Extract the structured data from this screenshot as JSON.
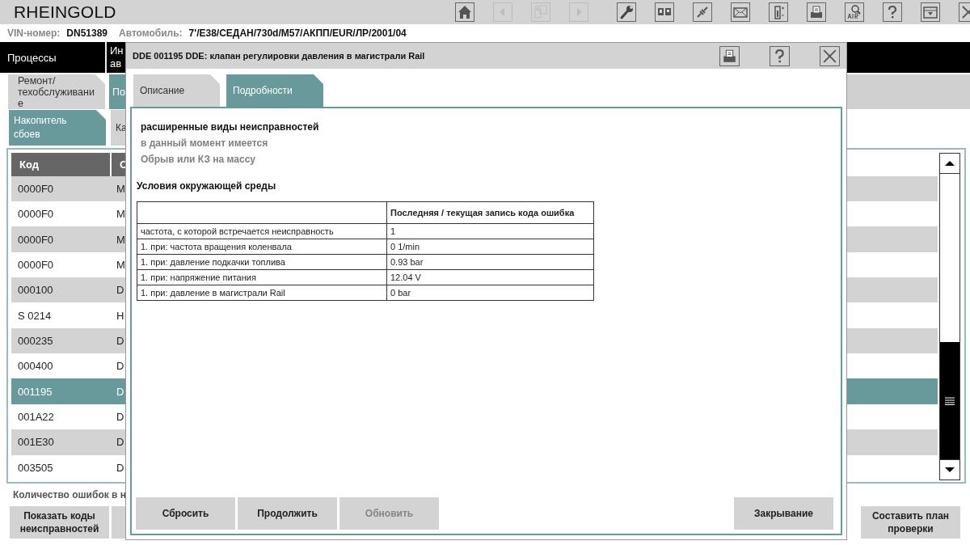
{
  "app": {
    "title": "RHEINGOLD"
  },
  "toolbar": [
    {
      "kind": "home",
      "disabled": false
    },
    {
      "kind": "back",
      "disabled": true
    },
    {
      "kind": "documents",
      "disabled": true
    },
    {
      "kind": "forward",
      "disabled": true
    },
    {
      "kind": "wrench",
      "disabled": false
    },
    {
      "kind": "panels",
      "disabled": false
    },
    {
      "kind": "plug",
      "disabled": false
    },
    {
      "kind": "mail",
      "disabled": false
    },
    {
      "kind": "battery",
      "disabled": false
    },
    {
      "kind": "print",
      "disabled": false
    },
    {
      "kind": "air",
      "disabled": false
    },
    {
      "kind": "help",
      "disabled": false
    },
    {
      "kind": "filter",
      "disabled": false
    },
    {
      "kind": "close",
      "disabled": false
    }
  ],
  "vehicle": {
    "vin_label": "VIN-номер:",
    "vin": "DN51389",
    "car_label": "Автомобиль:",
    "car": "7'/E38/СЕДАН/730d/M57/АКПП/EUR/ЛР/2001/04"
  },
  "nav_tabs": [
    {
      "lines": [
        "Процессы"
      ]
    },
    {
      "lines": [
        "Ин",
        "ав"
      ]
    }
  ],
  "sub_tabs": [
    {
      "lines": [
        "Ремонт/",
        "техобслуживани",
        "е"
      ],
      "selected": false
    },
    {
      "lines": [
        "По"
      ],
      "selected": true
    }
  ],
  "section_tabs": [
    {
      "lines": [
        "Накопитель",
        "сбоев"
      ],
      "selected": true
    },
    {
      "lines": [
        "Ка"
      ],
      "selected": false
    }
  ],
  "fault_table": {
    "columns": [
      "Код",
      "С"
    ],
    "rows": [
      {
        "cells": [
          "0000F0",
          "M"
        ],
        "selected": false
      },
      {
        "cells": [
          "0000F0",
          "M"
        ],
        "selected": false
      },
      {
        "cells": [
          "0000F0",
          "M"
        ],
        "selected": false
      },
      {
        "cells": [
          "0000F0",
          "M"
        ],
        "selected": false
      },
      {
        "cells": [
          "000100",
          "D"
        ],
        "selected": false
      },
      {
        "cells": [
          "S 0214",
          "H"
        ],
        "selected": false
      },
      {
        "cells": [
          "000235",
          "D"
        ],
        "selected": false
      },
      {
        "cells": [
          "000400",
          "D"
        ],
        "selected": false
      },
      {
        "cells": [
          "001195",
          "D"
        ],
        "selected": true
      },
      {
        "cells": [
          "001A22",
          "D"
        ],
        "selected": false
      },
      {
        "cells": [
          "001E30",
          "D"
        ],
        "selected": false
      },
      {
        "cells": [
          "003505",
          "D"
        ],
        "selected": false
      }
    ]
  },
  "fault_count": "Количество ошибок в н",
  "bottom_buttons": {
    "left": "Показать коды неисправностей",
    "right": "Составить план проверки"
  },
  "dialog": {
    "title": "DDE 001195 DDE: клапан регулировки давления в магистрали Rail",
    "title_actions": [
      {
        "kind": "print"
      },
      {
        "kind": "help"
      },
      {
        "kind": "close"
      }
    ],
    "tabs": [
      {
        "label": "Описание",
        "selected": false
      },
      {
        "label": "Подробности",
        "selected": true
      }
    ],
    "fault_type_heading": "расширенные виды неисправностей",
    "fault_status": "в данный момент имеется",
    "fault_description": "Обрыв или КЗ на массу",
    "conditions_heading": "Условия окружающей среды",
    "conditions_table": {
      "value_heading": "Последняя / текущая запись кода ошибка",
      "rows": [
        {
          "label": "частота, с которой встречается неисправность",
          "value": "1"
        },
        {
          "label": "1. при: частота вращения коленвала",
          "value": "0 1/min"
        },
        {
          "label": "1. при: давление подкачки топлива",
          "value": "0.93 bar"
        },
        {
          "label": "1. при: напряжение питания",
          "value": "12.04 V"
        },
        {
          "label": "1. при: давление в магистрали Rail",
          "value": "0 bar"
        }
      ]
    },
    "buttons": [
      {
        "label": "Сбросить",
        "disabled": false
      },
      {
        "label": "Продолжить",
        "disabled": false
      },
      {
        "label": "Обновить",
        "disabled": true
      }
    ],
    "close_button": {
      "label": "Закрывание"
    }
  }
}
